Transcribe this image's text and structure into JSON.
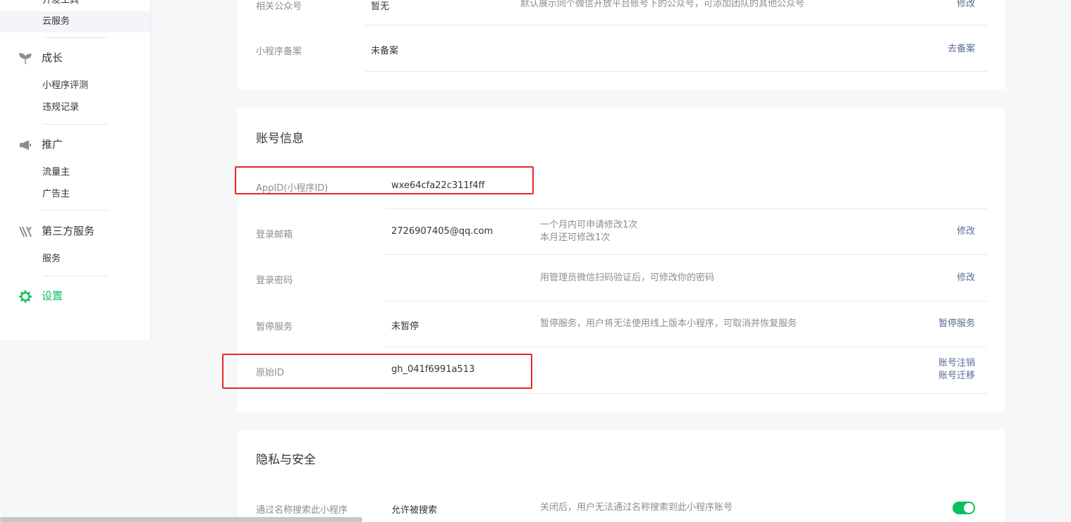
{
  "sidebar": {
    "dev_tools": "开发工具",
    "cloud_service": "云服务",
    "growth": {
      "title": "成长",
      "items": [
        "小程序评测",
        "违规记录"
      ]
    },
    "promotion": {
      "title": "推广",
      "items": [
        "流量主",
        "广告主"
      ]
    },
    "third_party": {
      "title": "第三方服务",
      "items": [
        "服务"
      ]
    },
    "settings": "设置"
  },
  "basic_card": {
    "rows": [
      {
        "label": "相关公众号",
        "value": "暂无",
        "desc": "默认展示同个微信开放平台账号下的公众号，可添加团队的其他公众号",
        "action": "修改"
      },
      {
        "label": "小程序备案",
        "value": "未备案",
        "action": "去备案"
      }
    ]
  },
  "account_card": {
    "title": "账号信息",
    "appid": {
      "label": "AppID(小程序ID)",
      "value": "wxe64cfa22c311f4ff"
    },
    "email": {
      "label": "登录邮箱",
      "value": "2726907405@qq.com",
      "desc1": "一个月内可申请修改1次",
      "desc2": "本月还可修改1次",
      "action": "修改"
    },
    "password": {
      "label": "登录密码",
      "desc": "用管理员微信扫码验证后，可修改你的密码",
      "action": "修改"
    },
    "pause": {
      "label": "暂停服务",
      "value": "未暂停",
      "desc": "暂停服务，用户将无法使用线上版本小程序，可取消并恢复服务",
      "action": "暂停服务"
    },
    "original_id": {
      "label": "原始ID",
      "value": "gh_041f6991a513",
      "action1": "账号注销",
      "action2": "账号迁移"
    }
  },
  "privacy_card": {
    "title": "隐私与安全",
    "search": {
      "label": "通过名称搜索此小程序",
      "value": "允许被搜索",
      "desc": "关闭后，用户无法通过名称搜索到此小程序账号",
      "enabled": true
    }
  },
  "colors": {
    "accent": "#07c160",
    "link": "#576b95",
    "highlight": "#e82727"
  }
}
